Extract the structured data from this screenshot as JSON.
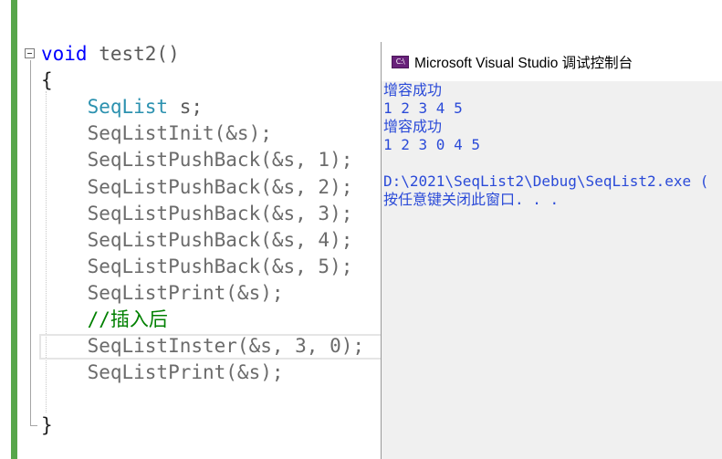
{
  "editor": {
    "lines": [
      {
        "parts": [
          {
            "t": "void",
            "c": "kw"
          },
          {
            "t": " test2()",
            "c": "fn"
          }
        ]
      },
      {
        "parts": [
          {
            "t": "{",
            "c": "pn"
          }
        ]
      },
      {
        "parts": [
          {
            "t": "    ",
            "c": "pn"
          },
          {
            "t": "SeqList",
            "c": "ty"
          },
          {
            "t": " s;",
            "c": "fn"
          }
        ]
      },
      {
        "parts": [
          {
            "t": "    SeqListInit(&s);",
            "c": "gray"
          }
        ]
      },
      {
        "parts": [
          {
            "t": "    SeqListPushBack(&s, 1);",
            "c": "gray"
          }
        ]
      },
      {
        "parts": [
          {
            "t": "    SeqListPushBack(&s, 2);",
            "c": "gray"
          }
        ]
      },
      {
        "parts": [
          {
            "t": "    SeqListPushBack(&s, 3);",
            "c": "gray"
          }
        ]
      },
      {
        "parts": [
          {
            "t": "    SeqListPushBack(&s, 4);",
            "c": "gray"
          }
        ]
      },
      {
        "parts": [
          {
            "t": "    SeqListPushBack(&s, 5);",
            "c": "gray"
          }
        ]
      },
      {
        "parts": [
          {
            "t": "    SeqListPrint(&s);",
            "c": "gray"
          }
        ]
      },
      {
        "parts": [
          {
            "t": "    //插入后",
            "c": "cm"
          }
        ]
      },
      {
        "parts": [
          {
            "t": "    SeqListInster(&s, 3, 0);",
            "c": "gray"
          }
        ]
      },
      {
        "parts": [
          {
            "t": "    SeqListPrint(&s);",
            "c": "gray"
          }
        ]
      },
      {
        "parts": [
          {
            "t": "",
            "c": "pn"
          }
        ]
      },
      {
        "parts": [
          {
            "t": "}",
            "c": "pn"
          }
        ]
      }
    ]
  },
  "console": {
    "title": "Microsoft Visual Studio 调试控制台",
    "icon": "visual-studio-console-icon",
    "icon_text": "C:\\",
    "output": [
      "增容成功",
      "1 2 3 4 5",
      "增容成功",
      "1 2 3 0 4 5",
      "",
      "D:\\2021\\SeqList2\\Debug\\SeqList2.exe (",
      "按任意键关闭此窗口. . ."
    ]
  },
  "colors": {
    "keyword": "#0000ff",
    "type": "#2b91af",
    "comment": "#008000",
    "console_text": "#2a4ad8",
    "change_margin": "#57a64a"
  }
}
